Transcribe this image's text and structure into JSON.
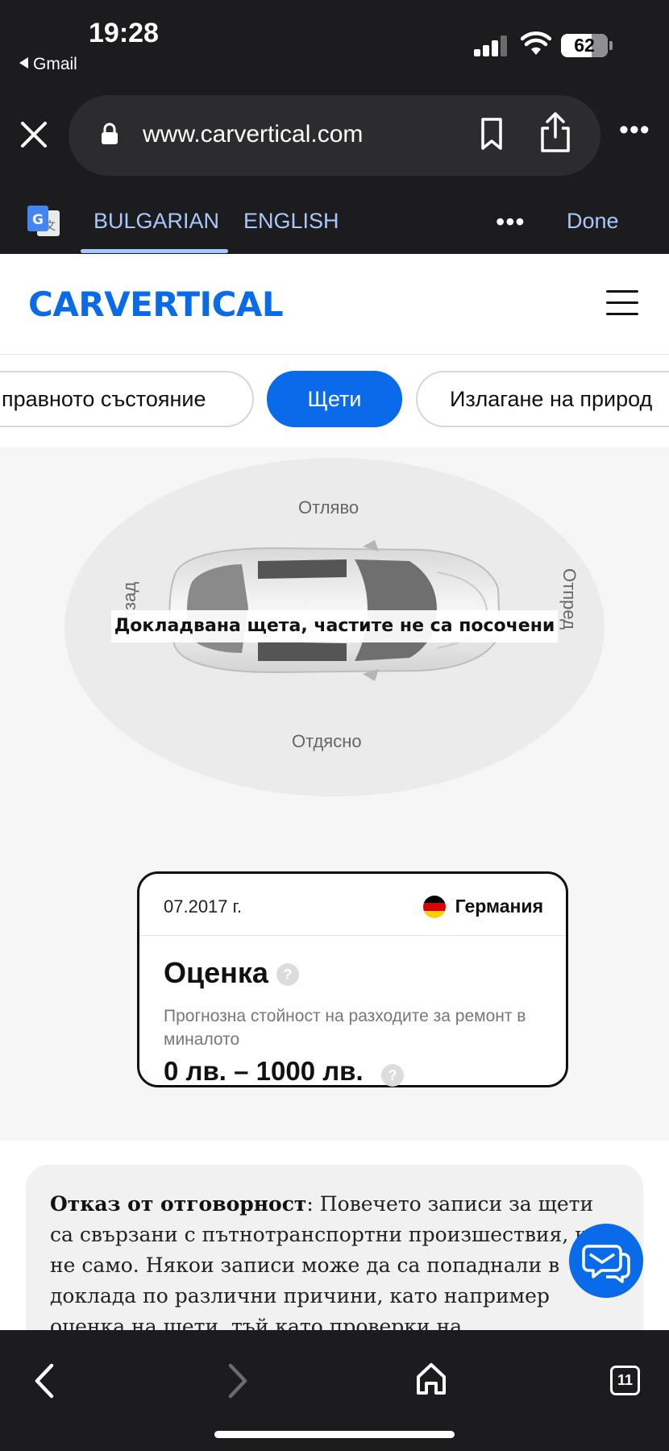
{
  "status_bar": {
    "time": "19:28",
    "back_app": "Gmail",
    "battery": "62"
  },
  "browser": {
    "url": "www.carvertical.com"
  },
  "translate": {
    "lang_1": "BULGARIAN",
    "lang_2": "ENGLISH",
    "done": "Done"
  },
  "site": {
    "logo": "CARVERTICAL"
  },
  "chips": [
    {
      "label": "правното състояние"
    },
    {
      "label": "Щети"
    },
    {
      "label": "Излагане на природ"
    }
  ],
  "damage_diagram": {
    "top": "Отляво",
    "bottom": "Отдясно",
    "left": "Отзад",
    "right": "Отпред",
    "message": "Докладвана щета, частите не са посочени"
  },
  "record": {
    "date": "07.2017 г.",
    "country": "Германия",
    "title": "Оценка",
    "description": "Прогнозна стойност на разходите за ремонт в миналото",
    "amount": "0 лв. – 1000 лв."
  },
  "disclaimer": {
    "title": "Отказ от отговорност",
    "text": ": Повечето записи за щети са свързани с пътнотранспортни произшествия, но не само. Някои записи може да са попаднали в доклада по различни причини, като например оценка на щети, тъй като проверки на"
  },
  "bottom_bar": {
    "tabs_count": "11"
  },
  "colors": {
    "brand": "#0a6bea",
    "translate_accent": "#a8c7fa"
  }
}
